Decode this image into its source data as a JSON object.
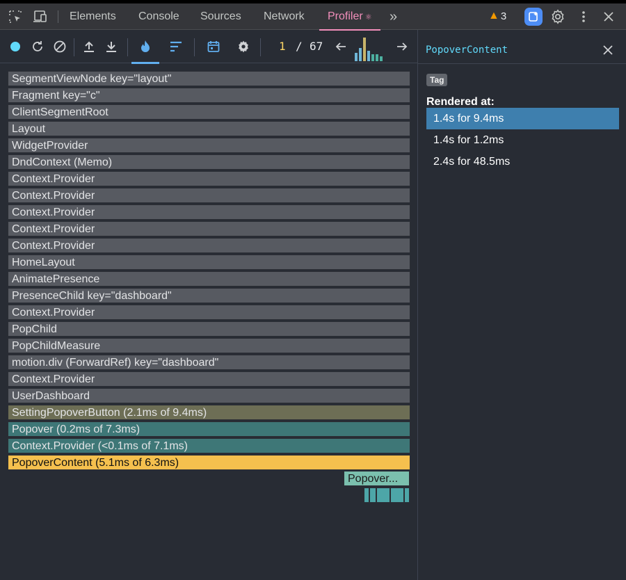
{
  "tabs": [
    "Elements",
    "Console",
    "Sources",
    "Network"
  ],
  "active_tab": "Profiler",
  "active_tab_glyph": "⚛",
  "more_tabs_glyph": "»",
  "warnings_count": "3",
  "toolbar": {
    "commit_index": "1",
    "commit_separator": "/",
    "commit_total": "67",
    "commit_bars": [
      {
        "level": 0.35,
        "color": "#6fb6d7"
      },
      {
        "level": 0.55,
        "color": "#6fb6d7"
      },
      {
        "level": 1.0,
        "color": "#c8b46a"
      },
      {
        "level": 0.45,
        "color": "#6fb6d7"
      },
      {
        "level": 0.3,
        "color": "#4db0a0"
      },
      {
        "level": 0.3,
        "color": "#4db0a0"
      },
      {
        "level": 0.2,
        "color": "#4db0a0"
      }
    ]
  },
  "flame_rows": [
    {
      "label": "SegmentViewNode key=\"layout\"",
      "kind": "grey"
    },
    {
      "label": "Fragment key=\"c\"",
      "kind": "grey"
    },
    {
      "label": "ClientSegmentRoot",
      "kind": "grey"
    },
    {
      "label": "Layout",
      "kind": "grey"
    },
    {
      "label": "WidgetProvider",
      "kind": "grey"
    },
    {
      "label": "DndContext (Memo)",
      "kind": "grey"
    },
    {
      "label": "Context.Provider",
      "kind": "grey"
    },
    {
      "label": "Context.Provider",
      "kind": "grey"
    },
    {
      "label": "Context.Provider",
      "kind": "grey"
    },
    {
      "label": "Context.Provider",
      "kind": "grey"
    },
    {
      "label": "Context.Provider",
      "kind": "grey"
    },
    {
      "label": "HomeLayout",
      "kind": "grey"
    },
    {
      "label": "AnimatePresence",
      "kind": "grey"
    },
    {
      "label": "PresenceChild key=\"dashboard\"",
      "kind": "grey"
    },
    {
      "label": "Context.Provider",
      "kind": "grey"
    },
    {
      "label": "PopChild",
      "kind": "grey"
    },
    {
      "label": "PopChildMeasure",
      "kind": "grey"
    },
    {
      "label": "motion.div (ForwardRef) key=\"dashboard\"",
      "kind": "grey"
    },
    {
      "label": "Context.Provider",
      "kind": "grey"
    },
    {
      "label": "UserDashboard",
      "kind": "grey"
    },
    {
      "label": "SettingPopoverButton (2.1ms of 9.4ms)",
      "kind": "yellowish"
    },
    {
      "label": "Popover (0.2ms of 7.3ms)",
      "kind": "teal"
    },
    {
      "label": "Context.Provider (<0.1ms of 7.1ms)",
      "kind": "teal"
    },
    {
      "label": "PopoverContent (5.1ms of 6.3ms)",
      "kind": "selected"
    }
  ],
  "flame_child_label": "Popover...",
  "panel": {
    "title": "PopoverContent",
    "tag": "Tag",
    "rendered_at_label": "Rendered at:",
    "renders": [
      "1.4s for 9.4ms",
      "1.4s for 1.2ms",
      "2.4s for 48.5ms"
    ]
  }
}
